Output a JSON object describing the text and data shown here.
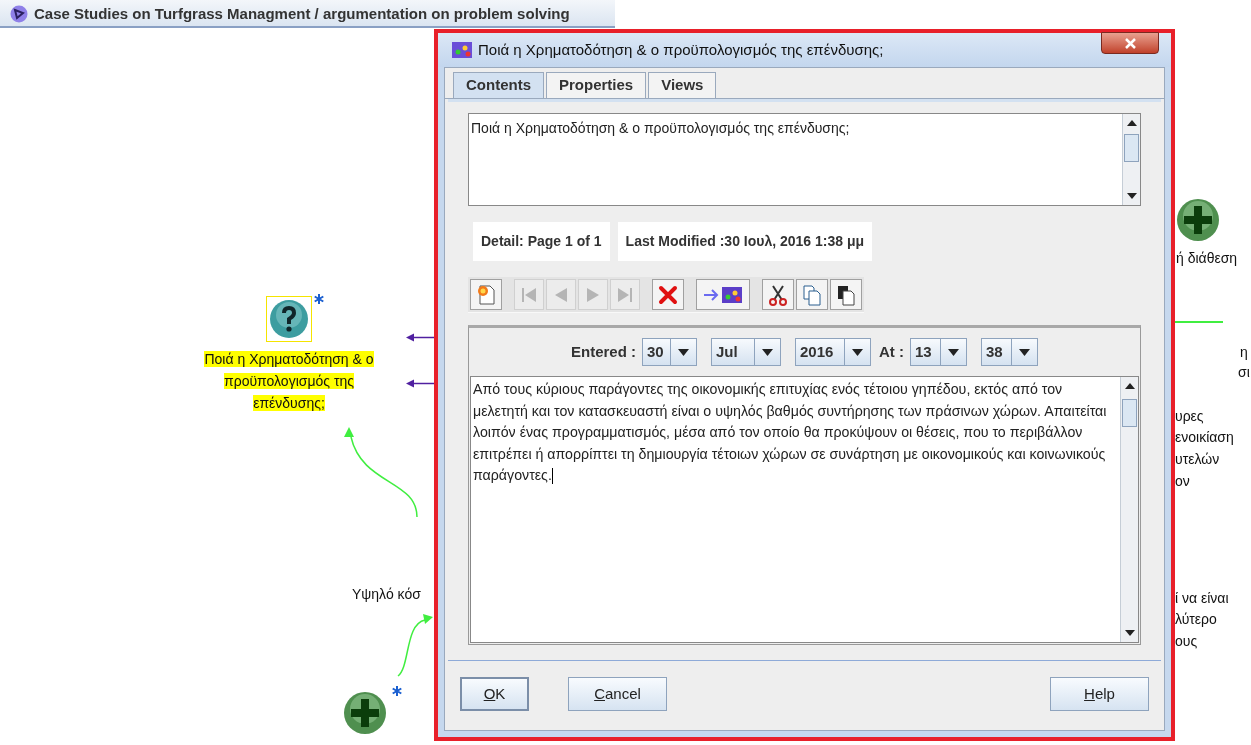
{
  "app": {
    "title": "Case Studies on Turfgrass Managment / argumentation on problem solving"
  },
  "map": {
    "nodes": [
      {
        "kind": "question",
        "label": "Ποιά η Χρηματοδότηση & ο προϋπολογισμός της επένδυσης;",
        "selected": true,
        "starred": true
      },
      {
        "kind": "plus",
        "selected": false,
        "starred": true
      },
      {
        "kind": "plus",
        "selected": false,
        "starred": false
      }
    ],
    "fragments": [
      {
        "text": "Υψηλό κόσ"
      },
      {
        "text": "ή διάθεση"
      },
      {
        "text": "η"
      },
      {
        "text": "σι"
      },
      {
        "text": "υρες"
      },
      {
        "text": "ενοικίαση"
      },
      {
        "text": "υτελών"
      },
      {
        "text": "ον"
      },
      {
        "text": "ί να είναι"
      },
      {
        "text": "λύτερο"
      },
      {
        "text": "ους"
      }
    ]
  },
  "dialog": {
    "title": "Ποιά η Χρηματοδότηση & ο προϋπολογισμός της επένδυσης;",
    "tabs": [
      {
        "label": "Contents",
        "selected": true
      },
      {
        "label": "Properties",
        "selected": false
      },
      {
        "label": "Views",
        "selected": false
      }
    ],
    "summary": "Ποιά η Χρηματοδότηση & ο προϋπολογισμός της επένδυσης;",
    "detail": "Detail: Page 1 of 1",
    "modified": "Last Modified :30 Ιουλ, 2016 1:38 μμ",
    "toolbar_groups": [
      {
        "buttons": [
          {
            "kind": "new",
            "disabled": false
          }
        ]
      },
      {
        "buttons": [
          {
            "kind": "first",
            "disabled": true
          },
          {
            "kind": "prev",
            "disabled": true
          },
          {
            "kind": "next",
            "disabled": true
          },
          {
            "kind": "last",
            "disabled": true
          }
        ]
      },
      {
        "buttons": [
          {
            "kind": "delete",
            "disabled": false
          }
        ]
      },
      {
        "buttons": [
          {
            "kind": "link",
            "disabled": false
          }
        ]
      },
      {
        "buttons": [
          {
            "kind": "cut",
            "disabled": false
          },
          {
            "kind": "copy",
            "disabled": false
          },
          {
            "kind": "paste",
            "disabled": false
          }
        ]
      }
    ],
    "entered": {
      "label": "Entered :",
      "day": "30",
      "month": "Jul",
      "year": "2016",
      "at_label": "At :",
      "hour": "13",
      "minute": "38"
    },
    "body": "Από τους κύριους παράγοντες της οικονομικής επιτυχίας ενός τέτοιου γηπέδου, εκτός από τον μελετητή και τον κατασκευαστή είναι ο υψηλός βαθμός συντήρησης των πράσινων χώρων. Απαιτείται λοιπόν ένας προγραμματισμός, μέσα από τον οποίο θα προκύψουν οι θέσεις, που το περιβάλλον επιτρέπει ή απορρίπτει τη δημιουργία τέτοιων χώρων σε συνάρτηση με οικονομικούς και κοινωνικούς παράγοντες.",
    "buttons": [
      {
        "label": "OK",
        "default": true
      },
      {
        "label": "Cancel",
        "default": false
      },
      {
        "label": "Help",
        "default": false
      }
    ]
  }
}
